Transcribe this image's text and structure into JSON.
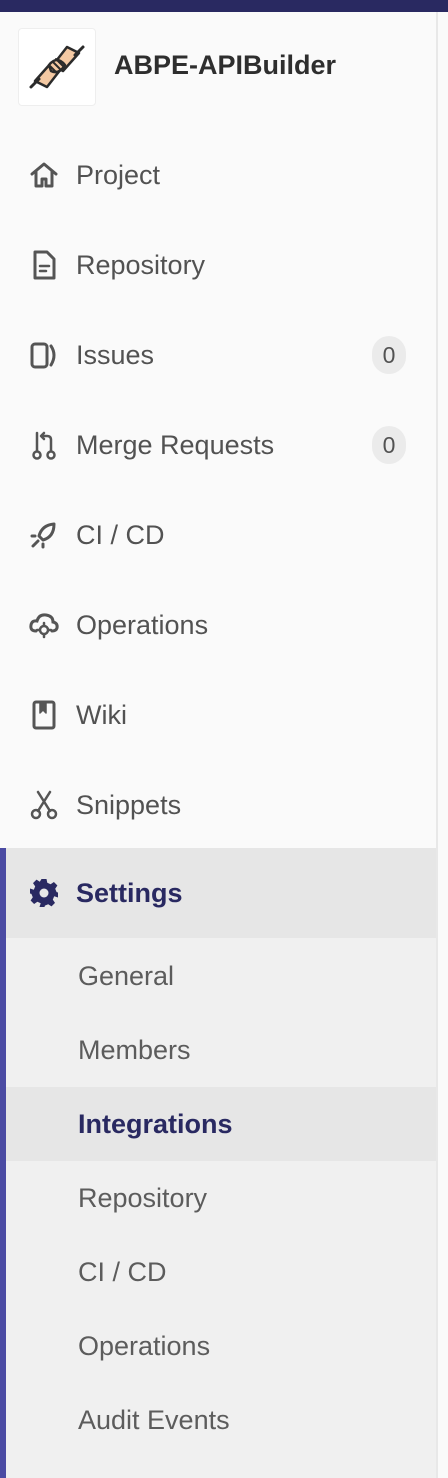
{
  "project": {
    "name": "ABPE-APIBuilder",
    "avatar_icon": "handshake-avatar"
  },
  "nav": {
    "items": [
      {
        "label": "Project",
        "icon": "home-icon"
      },
      {
        "label": "Repository",
        "icon": "document-icon"
      },
      {
        "label": "Issues",
        "icon": "issues-icon",
        "count": "0"
      },
      {
        "label": "Merge Requests",
        "icon": "merge-request-icon",
        "count": "0"
      },
      {
        "label": "CI / CD",
        "icon": "rocket-icon"
      },
      {
        "label": "Operations",
        "icon": "cloud-gear-icon"
      },
      {
        "label": "Wiki",
        "icon": "book-icon"
      },
      {
        "label": "Snippets",
        "icon": "scissors-icon"
      },
      {
        "label": "Settings",
        "icon": "gear-icon",
        "active": true
      }
    ]
  },
  "settings_submenu": {
    "items": [
      {
        "label": "General"
      },
      {
        "label": "Members"
      },
      {
        "label": "Integrations",
        "active": true
      },
      {
        "label": "Repository"
      },
      {
        "label": "CI / CD"
      },
      {
        "label": "Operations"
      },
      {
        "label": "Audit Events"
      }
    ]
  },
  "colors": {
    "topbar": "#292961",
    "active_accent": "#4b4ba3",
    "active_text": "#292961",
    "text": "#525252"
  }
}
